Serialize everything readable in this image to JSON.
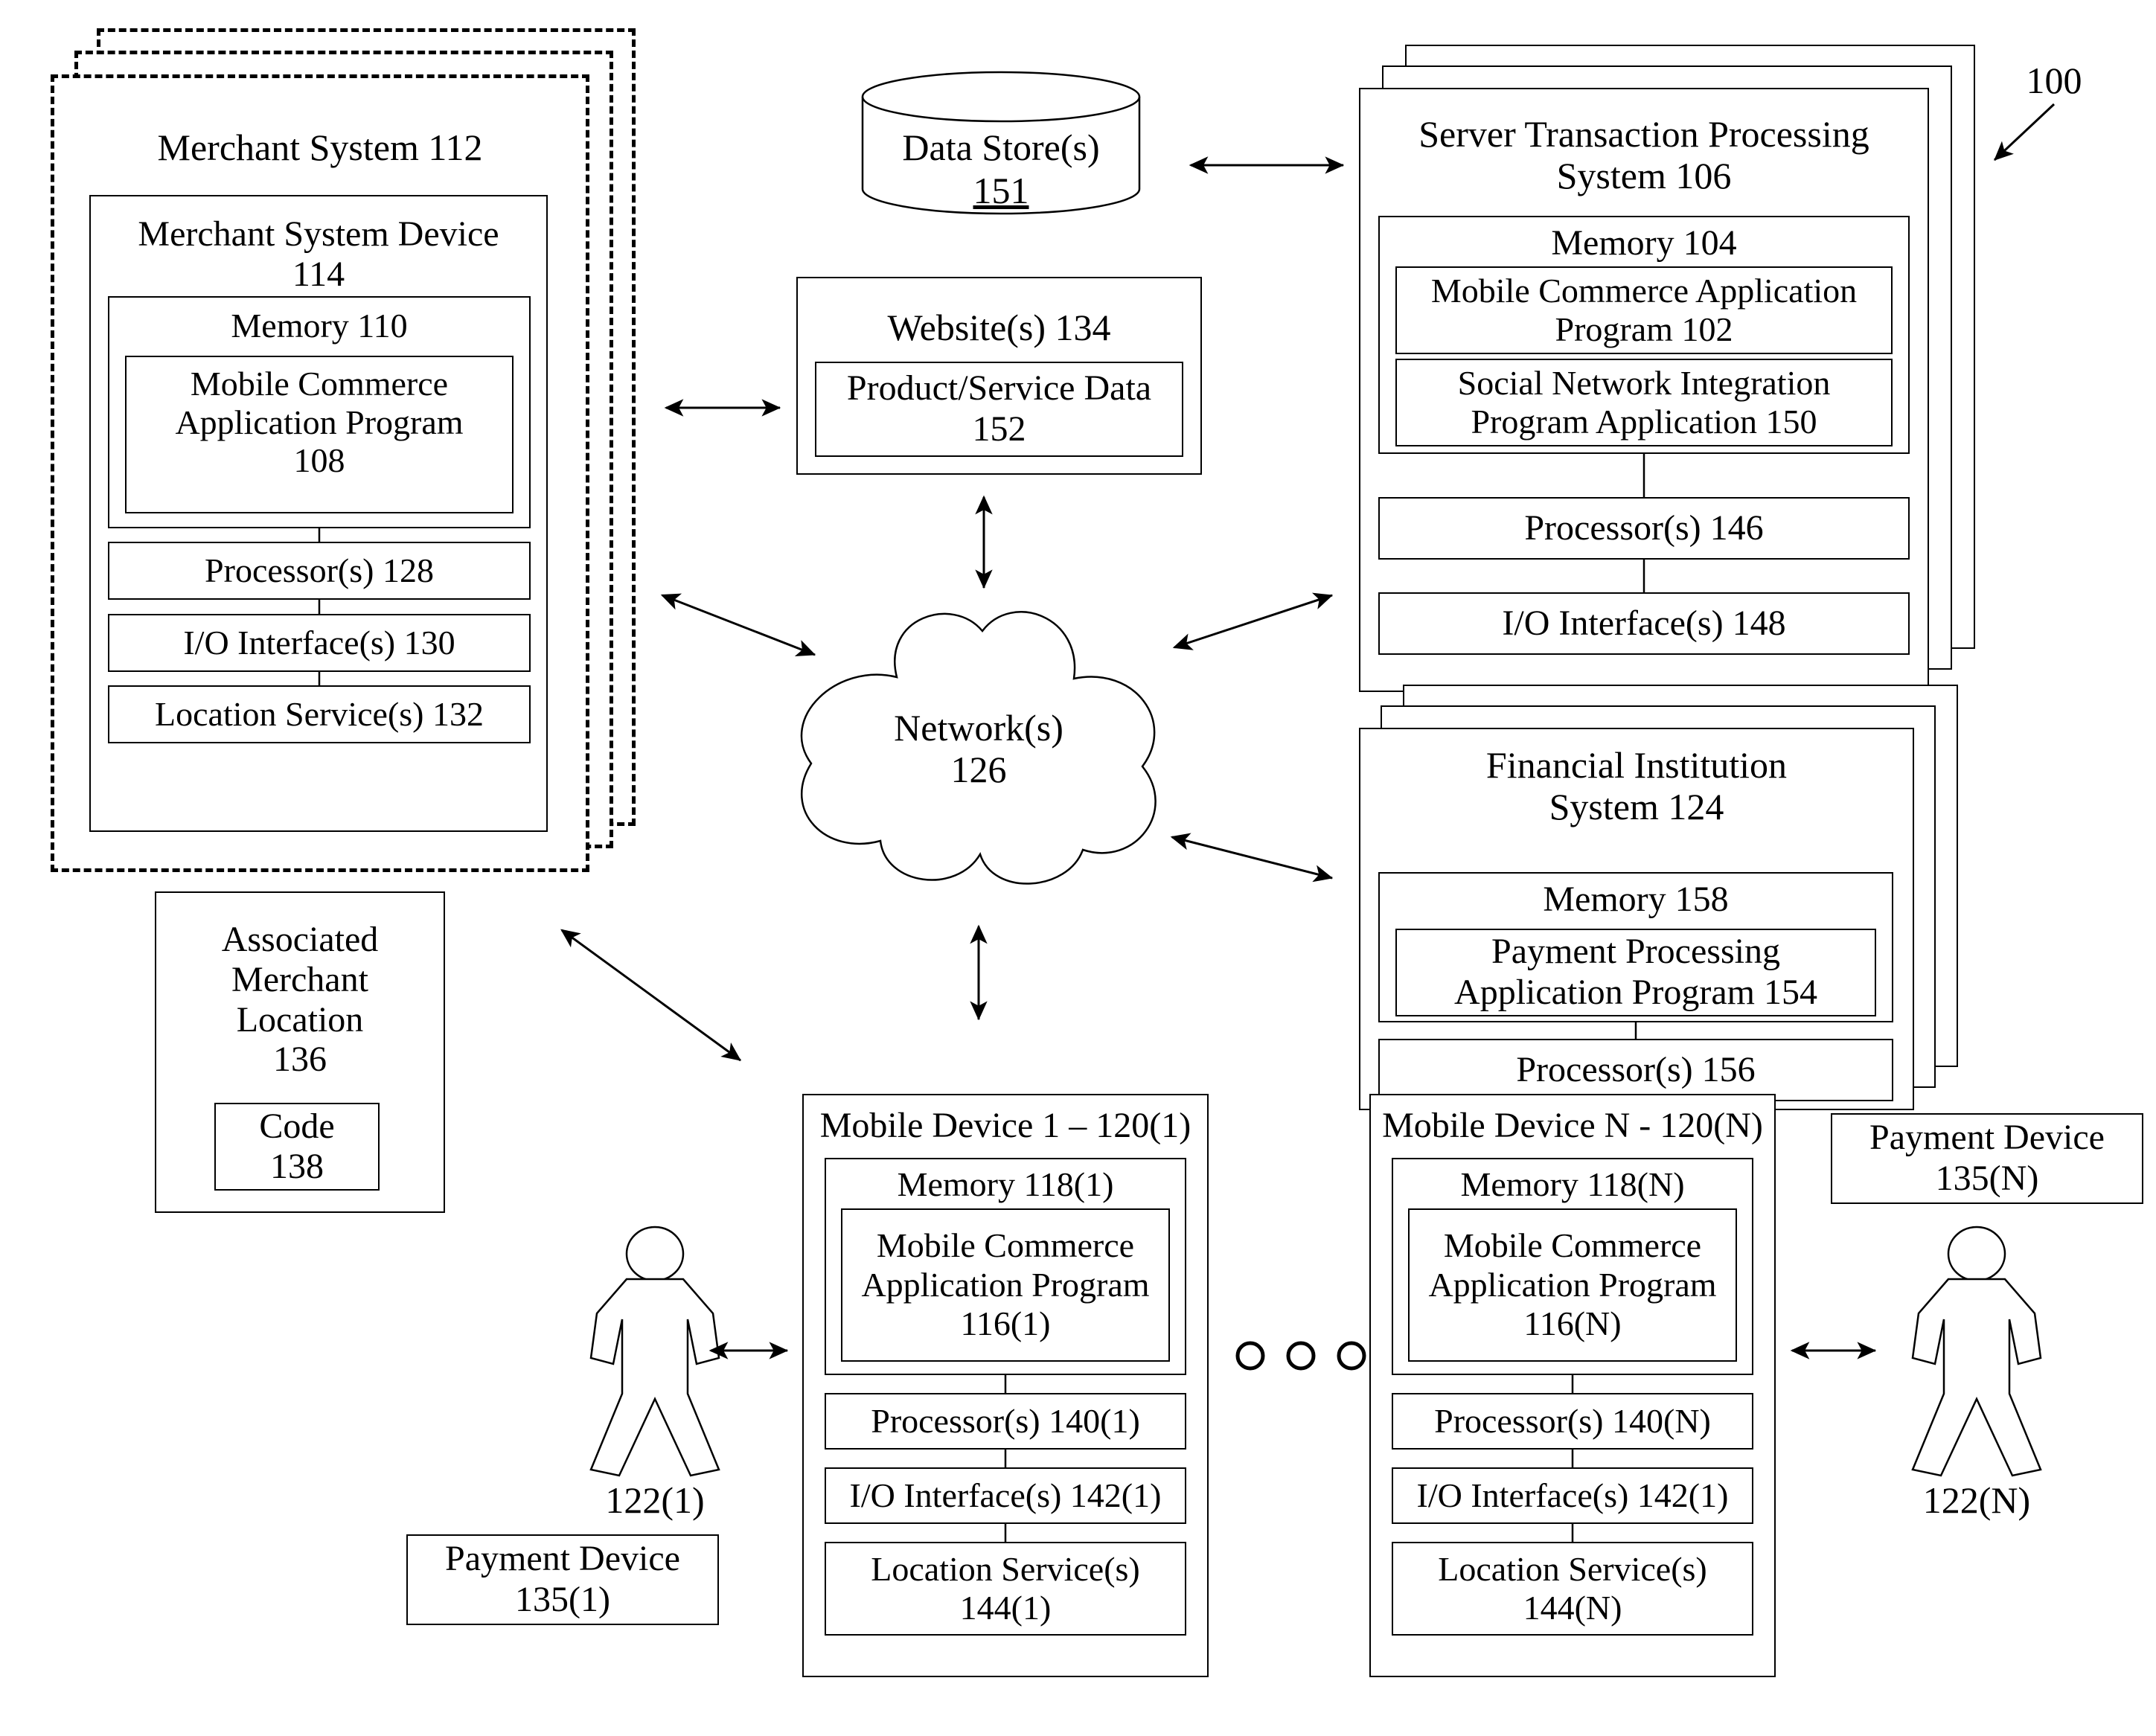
{
  "figure": {
    "reference_numeral": "100"
  },
  "merchant_system": {
    "title": "Merchant System 112",
    "device": {
      "title": "Merchant System Device\n114",
      "memory": {
        "title": "Memory 110",
        "program": "Mobile Commerce\nApplication Program\n108"
      },
      "processor": "Processor(s) 128",
      "io_interface": "I/O Interface(s) 130",
      "location_service": "Location Service(s) 132"
    }
  },
  "data_store": {
    "label": "Data Store(s)",
    "numeral": "151"
  },
  "websites": {
    "title": "Website(s) 134",
    "product_service_data": "Product/Service Data\n152"
  },
  "network": {
    "label": "Network(s)\n126"
  },
  "server_system": {
    "title": "Server Transaction Processing\nSystem 106",
    "memory": {
      "title": "Memory 104",
      "programs": [
        "Mobile Commerce Application\nProgram 102",
        "Social Network Integration\nProgram Application 150"
      ]
    },
    "processor": "Processor(s) 146",
    "io_interface": "I/O Interface(s) 148"
  },
  "financial_institution": {
    "title": "Financial Institution\nSystem 124",
    "memory": {
      "title": "Memory 158",
      "program": "Payment Processing\nApplication Program 154"
    },
    "processor": "Processor(s) 156"
  },
  "associated_merchant_location": {
    "title": "Associated\nMerchant\nLocation\n136",
    "code": "Code\n138"
  },
  "mobile_device_1": {
    "title": "Mobile Device 1 – 120(1)",
    "memory": {
      "title": "Memory 118(1)",
      "program": "Mobile Commerce\nApplication Program\n116(1)"
    },
    "processor": "Processor(s) 140(1)",
    "io_interface": "I/O Interface(s) 142(1)",
    "location_service": "Location Service(s)\n144(1)"
  },
  "mobile_device_n": {
    "title": "Mobile Device N - 120(N)",
    "memory": {
      "title": "Memory 118(N)",
      "program": "Mobile Commerce\nApplication Program\n116(N)"
    },
    "processor": "Processor(s) 140(N)",
    "io_interface": "I/O Interface(s) 142(1)",
    "location_service": "Location Service(s)\n144(N)"
  },
  "users": {
    "user_1_numeral": "122(1)",
    "user_n_numeral": "122(N)"
  },
  "payment_devices": {
    "device_1": "Payment Device\n135(1)",
    "device_n": "Payment Device\n135(N)"
  },
  "colors": {
    "line": "#000000",
    "background": "#ffffff"
  }
}
